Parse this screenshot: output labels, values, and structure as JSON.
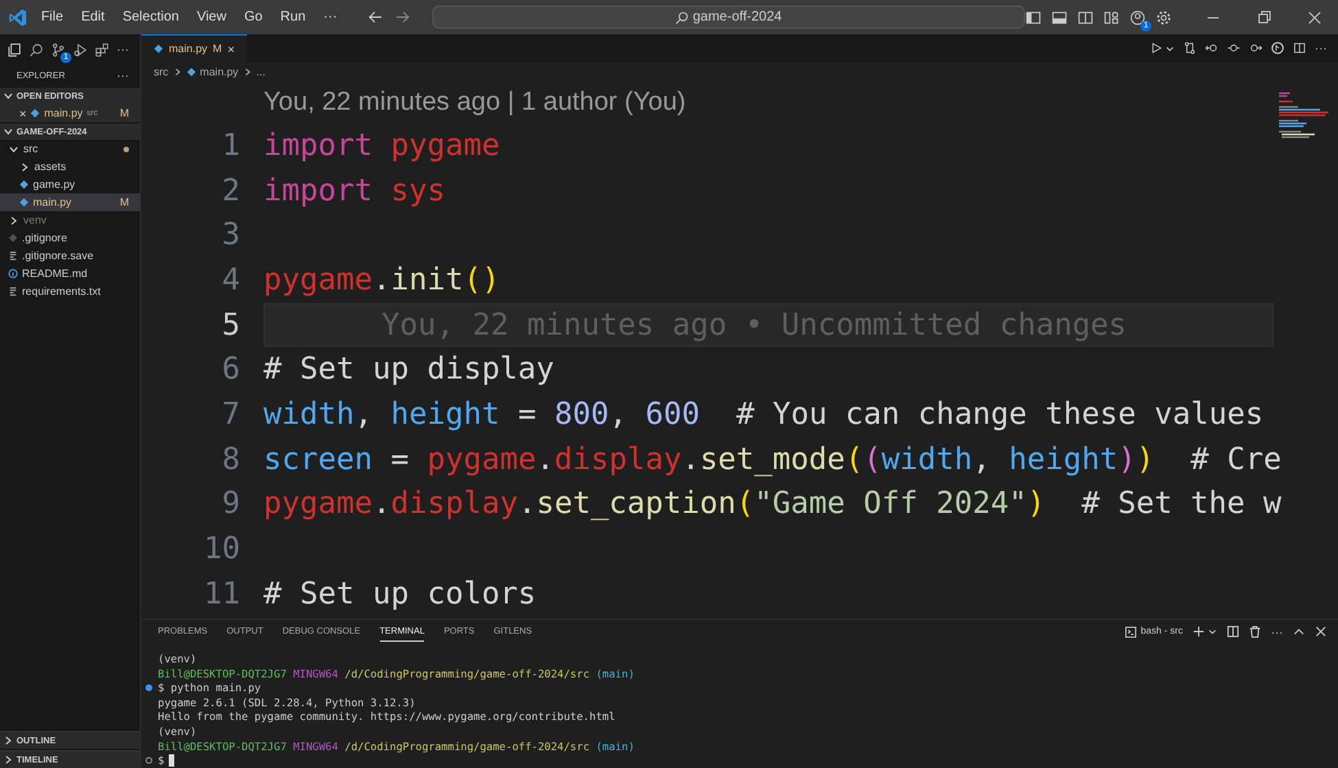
{
  "menu": [
    "File",
    "Edit",
    "Selection",
    "View",
    "Go",
    "Run",
    "···"
  ],
  "search": {
    "value": "game-off-2024"
  },
  "activity": {
    "source_control_badge": "1",
    "account_badge": "1"
  },
  "sidebar": {
    "title": "EXPLORER",
    "more": "···",
    "open_editors": {
      "title": "OPEN EDITORS",
      "expanded": true,
      "items": [
        {
          "close": "×",
          "name": "main.py",
          "folder": "src",
          "status": "M",
          "kind": "python"
        }
      ]
    },
    "project": {
      "title": "GAME-OFF-2024",
      "expanded": true,
      "tree": [
        {
          "name": "src",
          "kind": "folder",
          "expanded": true,
          "modified_dot": true,
          "dimmed": false,
          "selected": false,
          "children": [
            {
              "name": "assets",
              "kind": "folder",
              "expanded": false,
              "modified_dot": false,
              "dimmed": false,
              "selected": false
            },
            {
              "name": "game.py",
              "kind": "python",
              "modified_dot": false,
              "dimmed": false,
              "selected": false
            },
            {
              "name": "main.py",
              "kind": "python",
              "status": "M",
              "modified_dot": false,
              "dimmed": false,
              "selected": true
            }
          ]
        },
        {
          "name": "venv",
          "kind": "folder",
          "expanded": false,
          "modified_dot": false,
          "dimmed": true,
          "selected": false
        },
        {
          "name": ".gitignore",
          "kind": "git",
          "modified_dot": false,
          "dimmed": false,
          "selected": false
        },
        {
          "name": ".gitignore.save",
          "kind": "text",
          "modified_dot": false,
          "dimmed": false,
          "selected": false
        },
        {
          "name": "README.md",
          "kind": "info",
          "modified_dot": false,
          "dimmed": false,
          "selected": false
        },
        {
          "name": "requirements.txt",
          "kind": "text",
          "modified_dot": false,
          "dimmed": false,
          "selected": false
        }
      ]
    },
    "bottom_sections": [
      {
        "title": "OUTLINE",
        "expanded": false
      },
      {
        "title": "TIMELINE",
        "expanded": false
      }
    ]
  },
  "editor": {
    "tabs": [
      {
        "label": "main.py",
        "status": "M",
        "close": "×",
        "selected": true
      }
    ],
    "breadcrumb": [
      "src",
      "main.py",
      "..."
    ],
    "codelens": "You, 22 minutes ago | 1 author (You)",
    "lines": [
      {
        "number": "1",
        "current": false,
        "tokens": [
          {
            "text": "import ",
            "kind": "keyword"
          },
          {
            "text": "pygame",
            "kind": "module"
          }
        ]
      },
      {
        "number": "2",
        "current": false,
        "tokens": [
          {
            "text": "import ",
            "kind": "keyword"
          },
          {
            "text": "sys",
            "kind": "module"
          }
        ]
      },
      {
        "number": "3",
        "current": false
      },
      {
        "number": "4",
        "current": false,
        "tokens": [
          {
            "text": "pygame",
            "kind": "module"
          },
          {
            "text": ".",
            "kind": "plain"
          },
          {
            "text": "init",
            "kind": "func"
          },
          {
            "text": "()",
            "kind": "paren"
          }
        ]
      },
      {
        "number": "5",
        "current": true,
        "blame": "You, 22 minutes ago • Uncommitted changes"
      },
      {
        "number": "6",
        "current": false,
        "tokens": [
          {
            "text": "# Set up display",
            "kind": "comment"
          }
        ]
      },
      {
        "number": "7",
        "current": false,
        "tokens": [
          {
            "text": "width",
            "kind": "variable"
          },
          {
            "text": ", ",
            "kind": "plain"
          },
          {
            "text": "height",
            "kind": "variable"
          },
          {
            "text": " = ",
            "kind": "plain"
          },
          {
            "text": "800",
            "kind": "number"
          },
          {
            "text": ", ",
            "kind": "plain"
          },
          {
            "text": "600",
            "kind": "number"
          },
          {
            "text": "  # You can change these values",
            "kind": "comment"
          }
        ]
      },
      {
        "number": "8",
        "current": false,
        "tokens": [
          {
            "text": "screen",
            "kind": "variable"
          },
          {
            "text": " = ",
            "kind": "plain"
          },
          {
            "text": "pygame",
            "kind": "module"
          },
          {
            "text": ".",
            "kind": "plain"
          },
          {
            "text": "display",
            "kind": "module"
          },
          {
            "text": ".",
            "kind": "plain"
          },
          {
            "text": "set_mode",
            "kind": "func"
          },
          {
            "text": "(",
            "kind": "paren"
          },
          {
            "text": "(",
            "kind": "paren2"
          },
          {
            "text": "width",
            "kind": "variable"
          },
          {
            "text": ", ",
            "kind": "plain"
          },
          {
            "text": "height",
            "kind": "variable"
          },
          {
            "text": ")",
            "kind": "paren2"
          },
          {
            "text": ")",
            "kind": "paren"
          },
          {
            "text": "  # Cre",
            "kind": "comment"
          }
        ]
      },
      {
        "number": "9",
        "current": false,
        "tokens": [
          {
            "text": "pygame",
            "kind": "module"
          },
          {
            "text": ".",
            "kind": "plain"
          },
          {
            "text": "display",
            "kind": "module"
          },
          {
            "text": ".",
            "kind": "plain"
          },
          {
            "text": "set_caption",
            "kind": "func"
          },
          {
            "text": "(",
            "kind": "paren"
          },
          {
            "text": "\"Game Off 2024\"",
            "kind": "string"
          },
          {
            "text": ")",
            "kind": "paren"
          },
          {
            "text": "  # Set the w",
            "kind": "comment"
          }
        ]
      },
      {
        "number": "10",
        "current": false
      },
      {
        "number": "11",
        "current": false,
        "tokens": [
          {
            "text": "# Set up colors",
            "kind": "comment"
          }
        ]
      }
    ]
  },
  "panel": {
    "tabs": [
      {
        "label": "PROBLEMS",
        "selected": false
      },
      {
        "label": "OUTPUT",
        "selected": false
      },
      {
        "label": "DEBUG CONSOLE",
        "selected": false
      },
      {
        "label": "TERMINAL",
        "selected": true
      },
      {
        "label": "PORTS",
        "selected": false
      },
      {
        "label": "GITLENS",
        "selected": false
      }
    ],
    "terminal_profile": "bash - src",
    "terminal": [
      {
        "kind": "output",
        "cursor": false,
        "segments": [
          {
            "text": "(venv)",
            "kind": "plain"
          }
        ]
      },
      {
        "kind": "output",
        "cursor": false,
        "segments": [
          {
            "text": "Bill@DESKTOP-DQT2JG7 ",
            "kind": "user"
          },
          {
            "text": "MINGW64 ",
            "kind": "host"
          },
          {
            "text": "/d/CodingProgramming/game-off-2024/src ",
            "kind": "path"
          },
          {
            "text": "(main)",
            "kind": "branch"
          }
        ]
      },
      {
        "kind": "command_done",
        "cursor": false,
        "segments": [
          {
            "text": "$ python main.py",
            "kind": "plain"
          }
        ]
      },
      {
        "kind": "output",
        "cursor": false,
        "segments": [
          {
            "text": "pygame 2.6.1 (SDL 2.28.4, Python 3.12.3)",
            "kind": "plain"
          }
        ]
      },
      {
        "kind": "output",
        "cursor": false,
        "segments": [
          {
            "text": "Hello from the pygame community. https://www.pygame.org/contribute.html",
            "kind": "plain"
          }
        ]
      },
      {
        "kind": "output",
        "cursor": false,
        "segments": [
          {
            "text": "(venv)",
            "kind": "plain"
          }
        ]
      },
      {
        "kind": "output",
        "cursor": false,
        "segments": [
          {
            "text": "Bill@DESKTOP-DQT2JG7 ",
            "kind": "user"
          },
          {
            "text": "MINGW64 ",
            "kind": "host"
          },
          {
            "text": "/d/CodingProgramming/game-off-2024/src ",
            "kind": "path"
          },
          {
            "text": "(main)",
            "kind": "branch"
          }
        ]
      },
      {
        "kind": "command_idle",
        "cursor": true,
        "segments": [
          {
            "text": "$",
            "kind": "plain"
          }
        ]
      }
    ]
  }
}
